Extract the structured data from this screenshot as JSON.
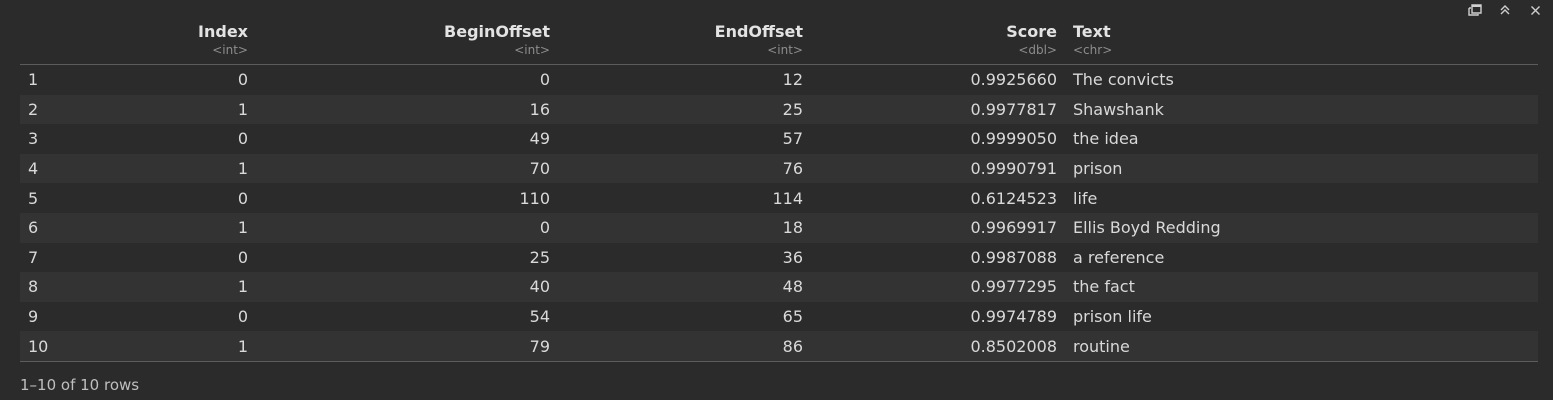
{
  "columns": [
    {
      "name": "Index",
      "type": "<int>"
    },
    {
      "name": "BeginOffset",
      "type": "<int>"
    },
    {
      "name": "EndOffset",
      "type": "<int>"
    },
    {
      "name": "Score",
      "type": "<dbl>"
    },
    {
      "name": "Text",
      "type": "<chr>"
    }
  ],
  "rows": [
    {
      "rn": "1",
      "index": "0",
      "begin": "0",
      "end": "12",
      "score": "0.9925660",
      "text": "The convicts"
    },
    {
      "rn": "2",
      "index": "1",
      "begin": "16",
      "end": "25",
      "score": "0.9977817",
      "text": "Shawshank"
    },
    {
      "rn": "3",
      "index": "0",
      "begin": "49",
      "end": "57",
      "score": "0.9999050",
      "text": "the idea"
    },
    {
      "rn": "4",
      "index": "1",
      "begin": "70",
      "end": "76",
      "score": "0.9990791",
      "text": "prison"
    },
    {
      "rn": "5",
      "index": "0",
      "begin": "110",
      "end": "114",
      "score": "0.6124523",
      "text": "life"
    },
    {
      "rn": "6",
      "index": "1",
      "begin": "0",
      "end": "18",
      "score": "0.9969917",
      "text": "Ellis Boyd Redding"
    },
    {
      "rn": "7",
      "index": "0",
      "begin": "25",
      "end": "36",
      "score": "0.9987088",
      "text": "a reference"
    },
    {
      "rn": "8",
      "index": "1",
      "begin": "40",
      "end": "48",
      "score": "0.9977295",
      "text": "the fact"
    },
    {
      "rn": "9",
      "index": "0",
      "begin": "54",
      "end": "65",
      "score": "0.9974789",
      "text": "prison life"
    },
    {
      "rn": "10",
      "index": "1",
      "begin": "79",
      "end": "86",
      "score": "0.8502008",
      "text": "routine"
    }
  ],
  "footer": "1–10 of 10 rows",
  "toolbar_icons": [
    "show-in-new-window-icon",
    "collapse-icon",
    "close-icon"
  ]
}
